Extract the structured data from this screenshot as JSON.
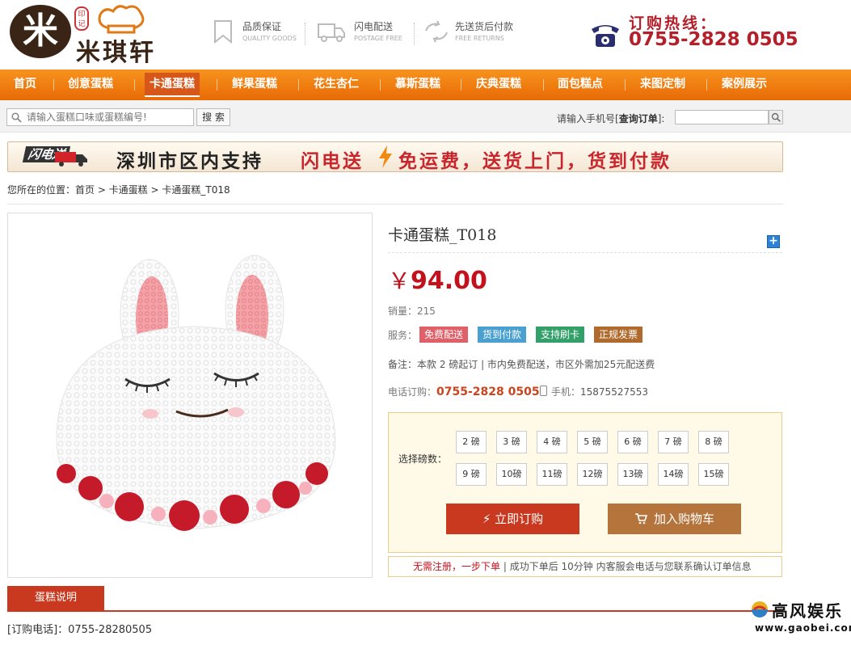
{
  "header": {
    "logo_mark": "米",
    "logo_stamp": "印记",
    "logo_text": "米琪轩",
    "promos": [
      {
        "title": "品质保证",
        "subtitle": "QUALITY GOODS"
      },
      {
        "title": "闪电配送",
        "subtitle": "POSTAGE FREE"
      },
      {
        "title": "先送货后付款",
        "subtitle": "FREE RETURNS"
      }
    ],
    "hotline_label": "订购热线：",
    "hotline_number": "0755-2828 0505"
  },
  "nav": {
    "items": [
      "首页",
      "创意蛋糕",
      "卡通蛋糕",
      "鲜果蛋糕",
      "花生杏仁",
      "慕斯蛋糕",
      "庆典蛋糕",
      "面包糕点",
      "来图定制",
      "案例展示"
    ],
    "active_index": 2
  },
  "search": {
    "placeholder": "请输入蛋糕口味或蛋糕编号!",
    "button": "搜 索",
    "order_label_prefix": "请输入手机号[",
    "order_label_bold": "查询订单",
    "order_label_suffix": "]:"
  },
  "banner": {
    "tag": "闪电送",
    "text1": "深圳市区内支持",
    "text2": "闪电送",
    "text3": "免运费，送货上门，货到付款"
  },
  "breadcrumb": "您所在的位置：首页 > 卡通蛋糕 > 卡通蛋糕_T018",
  "product": {
    "title": "卡通蛋糕_T018",
    "currency": "￥",
    "price": "94.00",
    "sales_label": "销量：",
    "sales": "215",
    "service_label": "服务：",
    "services": [
      {
        "label": "免费配送",
        "color": "#e0606a"
      },
      {
        "label": "货到付款",
        "color": "#4aa0d0"
      },
      {
        "label": "支持刷卡",
        "color": "#33a06a"
      },
      {
        "label": "正规发票",
        "color": "#b06a2c"
      }
    ],
    "note": "备注：本款 2 磅起订 | 市内免费配送，市区外需加25元配送费",
    "phone_label": "电话订购：",
    "phone": "0755-2828 0505",
    "mobile_label": "手机：",
    "mobile": "15875527553",
    "weight_label": "选择磅数：",
    "weights": [
      "2 磅",
      "3 磅",
      "4 磅",
      "5 磅",
      "6 磅",
      "7 磅",
      "8 磅",
      "9 磅",
      "10磅",
      "11磅",
      "12磅",
      "13磅",
      "14磅",
      "15磅"
    ],
    "buy_label": "立即订购",
    "cart_label": "加入购物车",
    "note_box_highlight": "无需注册，一步下单",
    "note_box_text": " | 成功下单后 10分钟 内客服会电话与您联系确认订单信息"
  },
  "tabs": {
    "description": "蛋糕说明"
  },
  "contact": "[订购电话]：0755-28280505",
  "watermark": {
    "name": "高风娱乐",
    "url": "www.gaobei.com"
  }
}
